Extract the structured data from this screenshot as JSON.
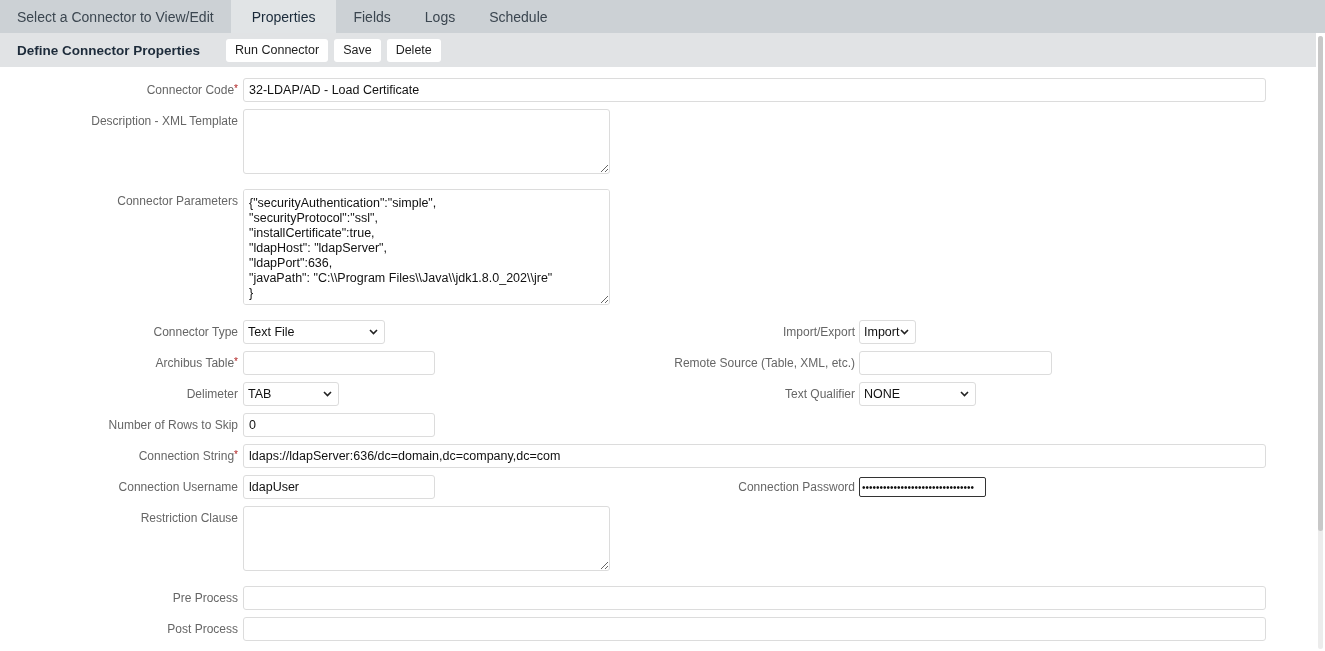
{
  "tabs": [
    {
      "label": "Select a Connector to View/Edit",
      "selected": false
    },
    {
      "label": "Properties",
      "selected": true
    },
    {
      "label": "Fields",
      "selected": false
    },
    {
      "label": "Logs",
      "selected": false
    },
    {
      "label": "Schedule",
      "selected": false
    }
  ],
  "panel": {
    "title": "Define Connector Properties",
    "buttons": [
      "Run Connector",
      "Save",
      "Delete"
    ]
  },
  "form": {
    "rows": [
      {
        "fields": [
          {
            "label": "Connector Code",
            "required_mark": "*",
            "kind": "text",
            "value": "32-LDAP/AD - Load Certificate"
          }
        ]
      },
      {
        "fields": [
          {
            "label": "Description - XML Template",
            "kind": "textarea"
          }
        ]
      },
      {
        "fields": [
          {
            "label": "Connector Parameters",
            "kind": "textarea",
            "value": "{\"securityAuthentication\":\"simple\",\n\"securityProtocol\":\"ssl\",\n\"installCertificate\":true,\n\"ldapHost\": \"ldapServer\",\n\"ldapPort\":636,\n\"javaPath\": \"C:\\\\Program Files\\\\Java\\\\jdk1.8.0_202\\\\jre\"\n}"
          }
        ]
      },
      {
        "fields": [
          {
            "label": "Connector Type",
            "kind": "select",
            "value": "Text File"
          },
          {
            "label": "Import/Export",
            "kind": "select",
            "value": "Import"
          }
        ]
      },
      {
        "fields": [
          {
            "label": "Archibus Table",
            "required_mark": "*",
            "kind": "text"
          },
          {
            "label": "Remote Source (Table, XML, etc.)",
            "kind": "text"
          }
        ]
      },
      {
        "fields": [
          {
            "label": "Delimeter",
            "kind": "select",
            "value": "TAB"
          },
          {
            "label": "Text Qualifier",
            "kind": "select",
            "value": "NONE"
          }
        ]
      },
      {
        "fields": [
          {
            "label": "Number of Rows to Skip",
            "kind": "text",
            "value": "0"
          }
        ]
      },
      {
        "fields": [
          {
            "label": "Connection String",
            "required_mark": "*",
            "kind": "text",
            "value": "ldaps://ldapServer:636/dc=domain,dc=company,dc=com"
          }
        ]
      },
      {
        "fields": [
          {
            "label": "Connection Username",
            "kind": "text",
            "value": "ldapUser"
          },
          {
            "label": "Connection Password",
            "kind": "password",
            "focused": true,
            "value": "••••••••••••••••••••••••••••••••"
          }
        ]
      },
      {
        "fields": [
          {
            "label": "Restriction Clause",
            "kind": "textarea"
          }
        ]
      },
      {
        "fields": [
          {
            "label": "Pre Process",
            "kind": "text"
          }
        ]
      },
      {
        "fields": [
          {
            "label": "Post Process",
            "kind": "text"
          }
        ]
      }
    ]
  }
}
